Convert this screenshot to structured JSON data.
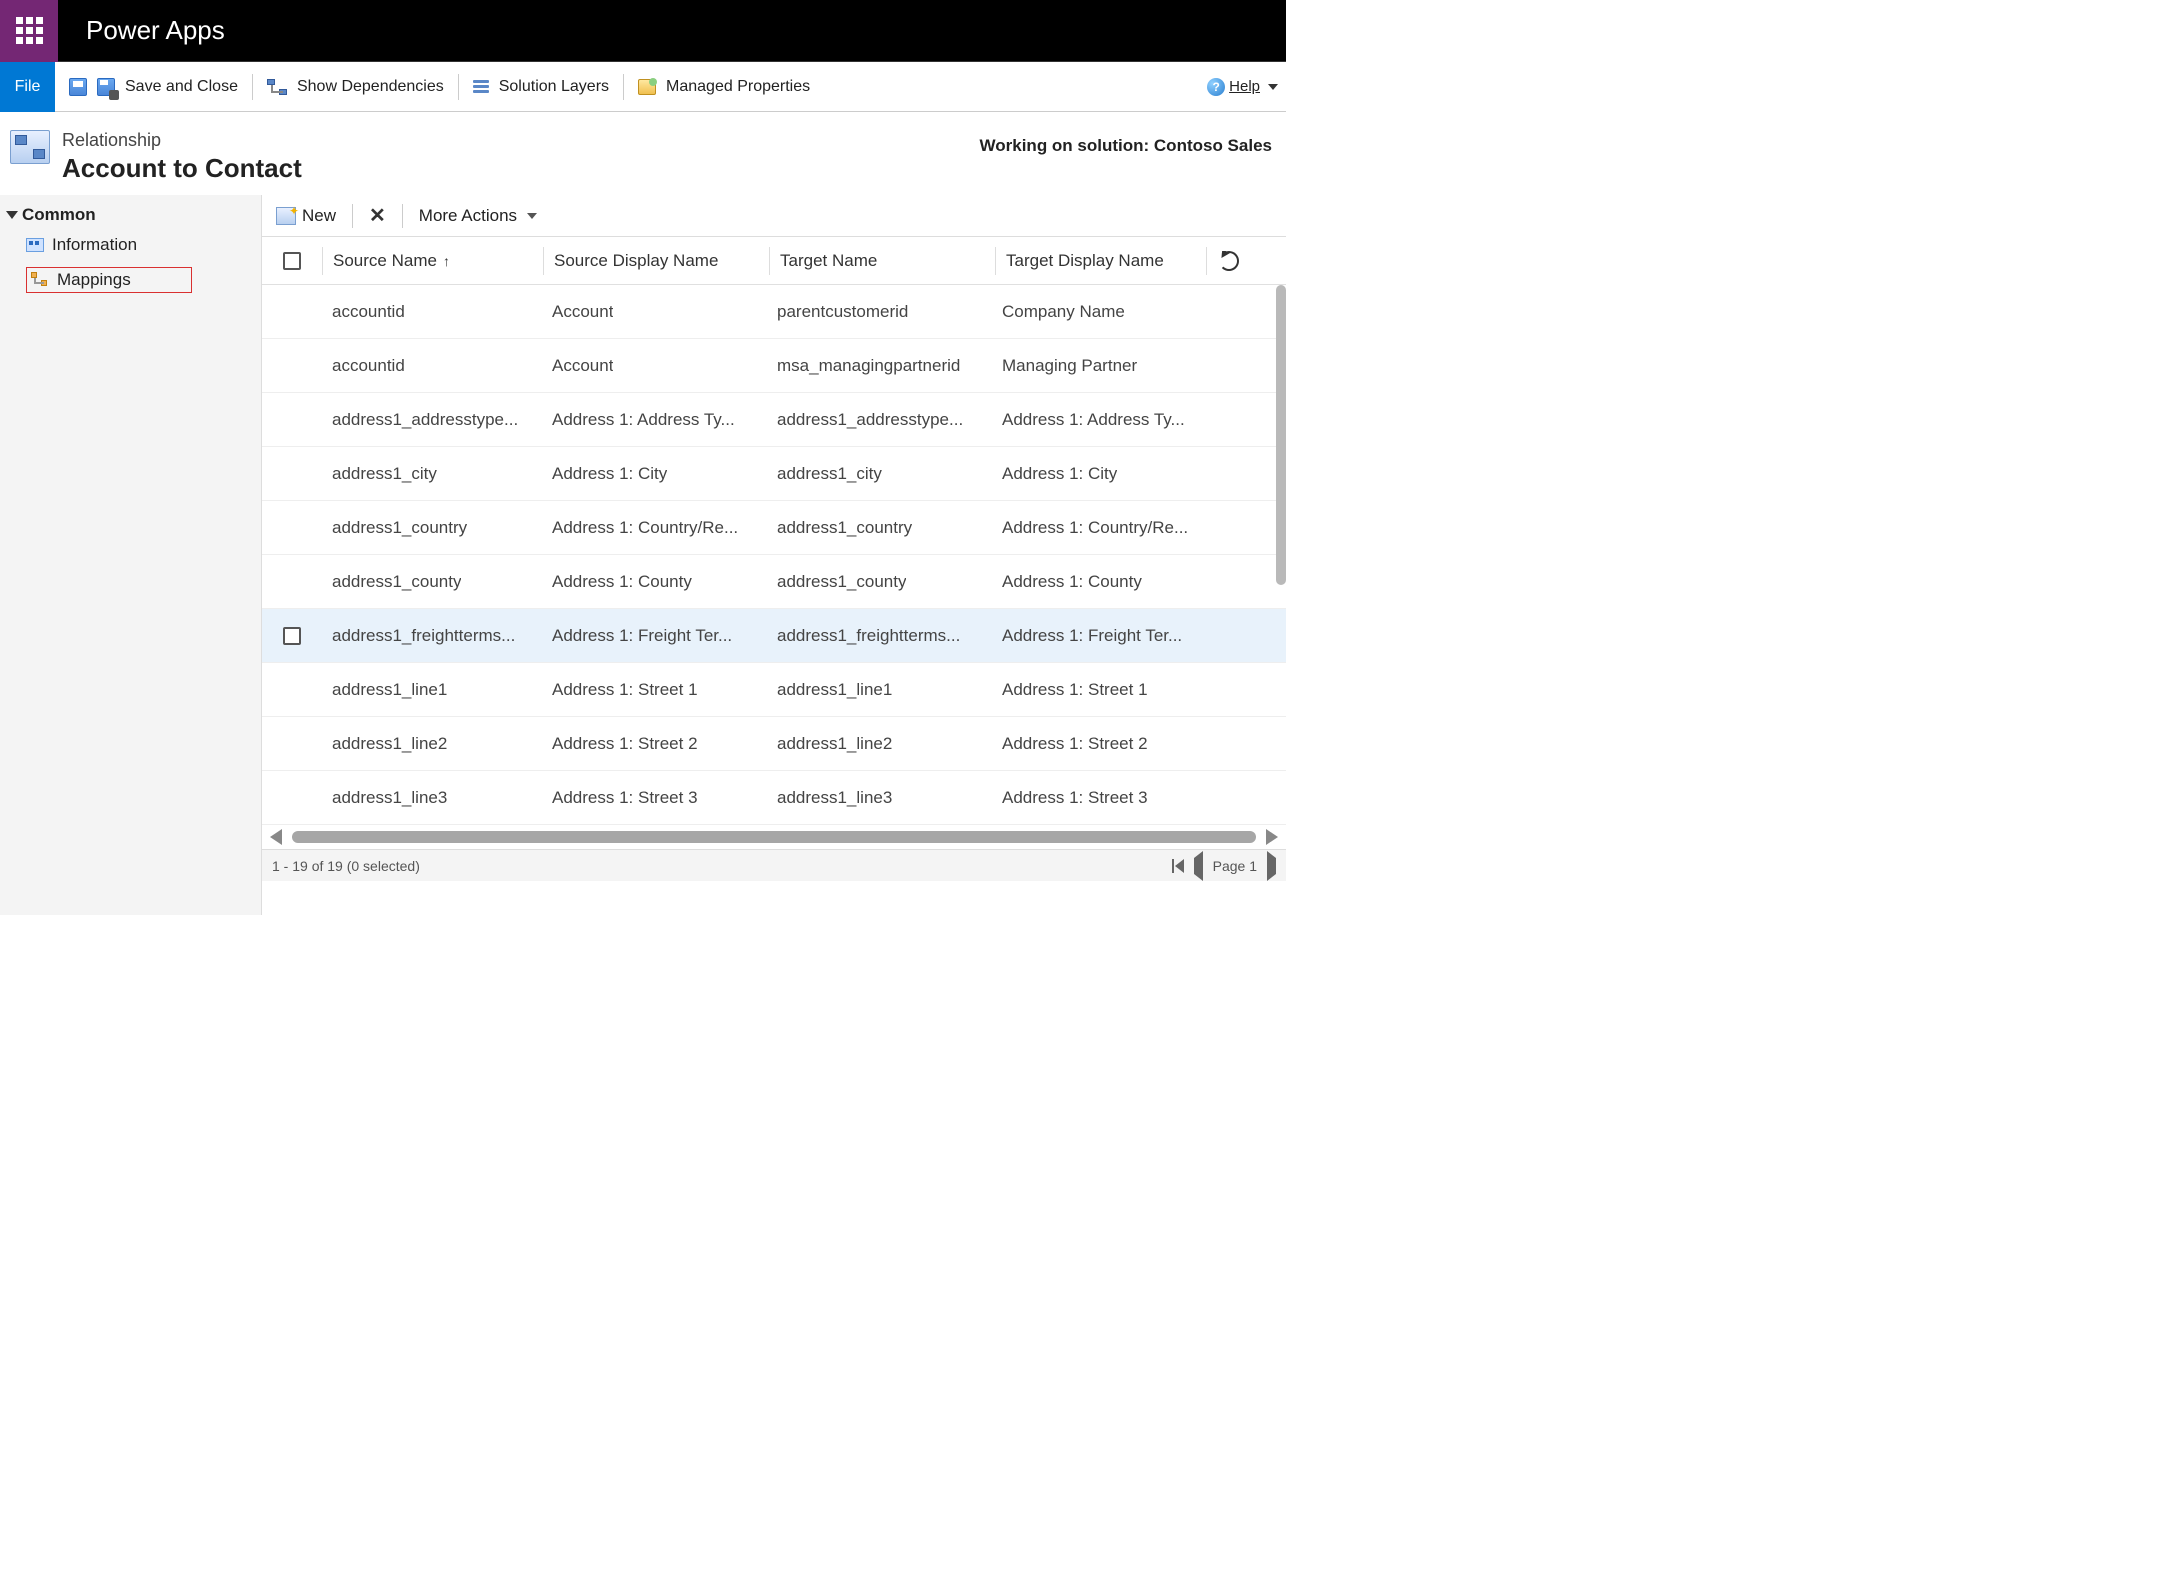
{
  "header": {
    "app_title": "Power Apps"
  },
  "command_bar": {
    "file": "File",
    "save_close": "Save and Close",
    "show_deps": "Show Dependencies",
    "solution_layers": "Solution Layers",
    "managed_props": "Managed Properties",
    "help": "Help"
  },
  "sub_header": {
    "label": "Relationship",
    "title": "Account to Contact",
    "solution_prefix": "Working on solution: ",
    "solution_name": "Contoso Sales"
  },
  "sidebar": {
    "root": "Common",
    "information": "Information",
    "mappings": "Mappings"
  },
  "main_toolbar": {
    "new": "New",
    "more_actions": "More Actions"
  },
  "grid": {
    "columns": {
      "source_name": "Source Name",
      "source_display": "Source Display Name",
      "target_name": "Target Name",
      "target_display": "Target Display Name"
    },
    "rows": [
      {
        "source_name": "accountid",
        "source_display": "Account",
        "target_name": "parentcustomerid",
        "target_display": "Company Name"
      },
      {
        "source_name": "accountid",
        "source_display": "Account",
        "target_name": "msa_managingpartnerid",
        "target_display": "Managing Partner"
      },
      {
        "source_name": "address1_addresstype...",
        "source_display": "Address 1: Address Ty...",
        "target_name": "address1_addresstype...",
        "target_display": "Address 1: Address Ty..."
      },
      {
        "source_name": "address1_city",
        "source_display": "Address 1: City",
        "target_name": "address1_city",
        "target_display": "Address 1: City"
      },
      {
        "source_name": "address1_country",
        "source_display": "Address 1: Country/Re...",
        "target_name": "address1_country",
        "target_display": "Address 1: Country/Re..."
      },
      {
        "source_name": "address1_county",
        "source_display": "Address 1: County",
        "target_name": "address1_county",
        "target_display": "Address 1: County"
      },
      {
        "source_name": "address1_freightterms...",
        "source_display": "Address 1: Freight Ter...",
        "target_name": "address1_freightterms...",
        "target_display": "Address 1: Freight Ter..."
      },
      {
        "source_name": "address1_line1",
        "source_display": "Address 1: Street 1",
        "target_name": "address1_line1",
        "target_display": "Address 1: Street 1"
      },
      {
        "source_name": "address1_line2",
        "source_display": "Address 1: Street 2",
        "target_name": "address1_line2",
        "target_display": "Address 1: Street 2"
      },
      {
        "source_name": "address1_line3",
        "source_display": "Address 1: Street 3",
        "target_name": "address1_line3",
        "target_display": "Address 1: Street 3"
      }
    ]
  },
  "footer": {
    "status": "1 - 19 of 19 (0 selected)",
    "page": "Page 1"
  }
}
